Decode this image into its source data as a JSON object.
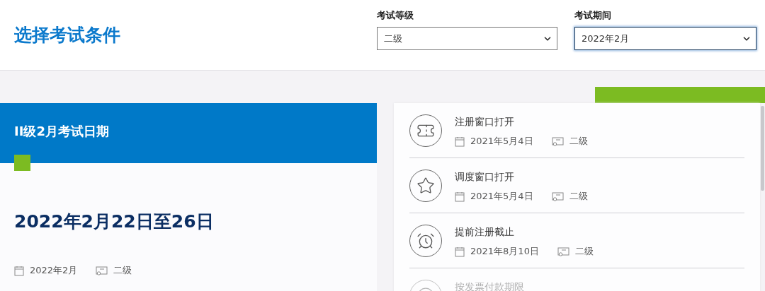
{
  "page_title": "选择考试条件",
  "filters": [
    {
      "label": "考试等级",
      "value": "二级",
      "focused": false
    },
    {
      "label": "考试期间",
      "value": "2022年2月",
      "focused": true
    }
  ],
  "exam_card": {
    "heading": "II级2月考试日期",
    "dates": "2022年2月22日至26日",
    "period": "2022年2月",
    "level": "二级"
  },
  "timeline": [
    {
      "kind": "ticket",
      "title": "注册窗口打开",
      "date": "2021年5月4日",
      "level": "二级"
    },
    {
      "kind": "star",
      "title": "调度窗口打开",
      "date": "2021年5月4日",
      "level": "二级"
    },
    {
      "kind": "alarm",
      "title": "提前注册截止",
      "date": "2021年8月10日",
      "level": "二级"
    },
    {
      "kind": "faded",
      "title": "按发票付款期限"
    }
  ]
}
